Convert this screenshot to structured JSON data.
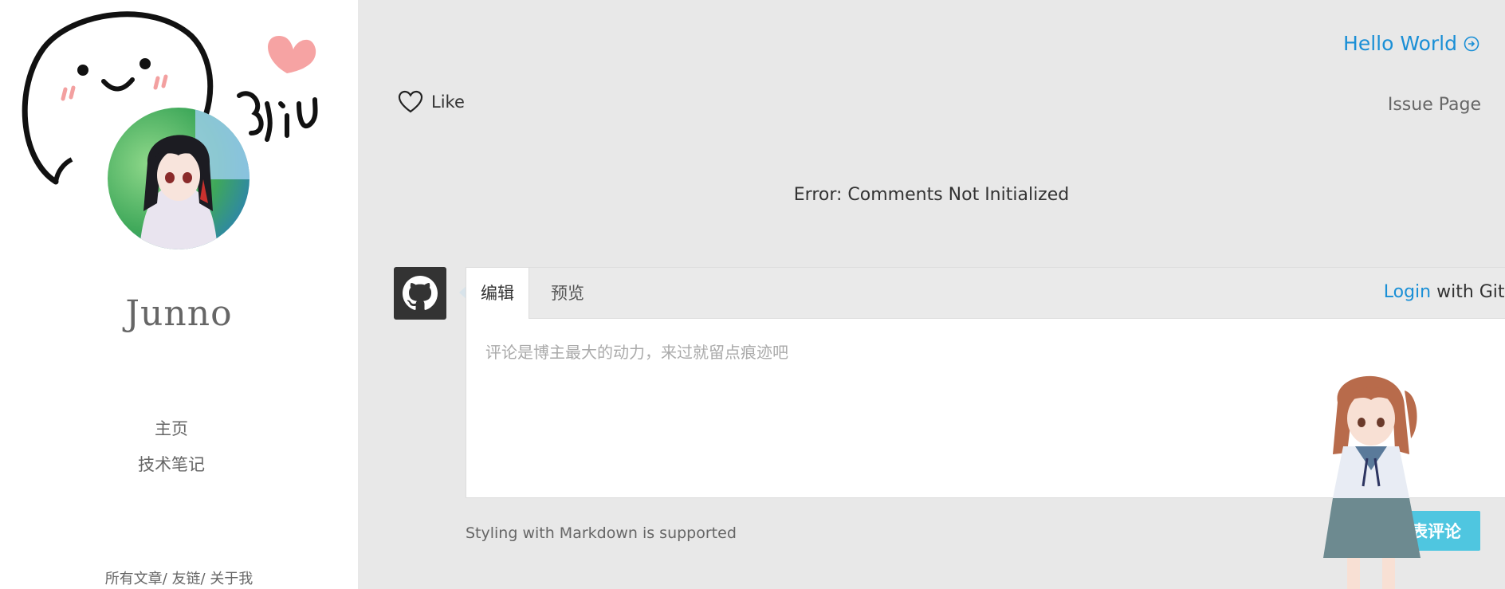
{
  "sidebar": {
    "site_title": "Junno",
    "nav": [
      {
        "label": "主页"
      },
      {
        "label": "技术笔记"
      }
    ],
    "footer": {
      "links": [
        "所有文章",
        "友链",
        "关于我"
      ],
      "separator": "/"
    }
  },
  "header": {
    "next_post": "Hello World",
    "like_label": "Like",
    "issue_page": "Issue Page"
  },
  "comments": {
    "error": "Error: Comments Not Initialized",
    "tabs": [
      "编辑",
      "预览"
    ],
    "login_link": "Login",
    "login_suffix": " with GitHub",
    "placeholder": "评论是博主最大的动力，来过就留点痕迹吧",
    "markdown_note": "Styling with Markdown is supported",
    "submit": "发表评论"
  },
  "colors": {
    "accent": "#1a8fd6",
    "submit_bg": "#4fc6e0",
    "page_bg": "#e8e8e8"
  }
}
